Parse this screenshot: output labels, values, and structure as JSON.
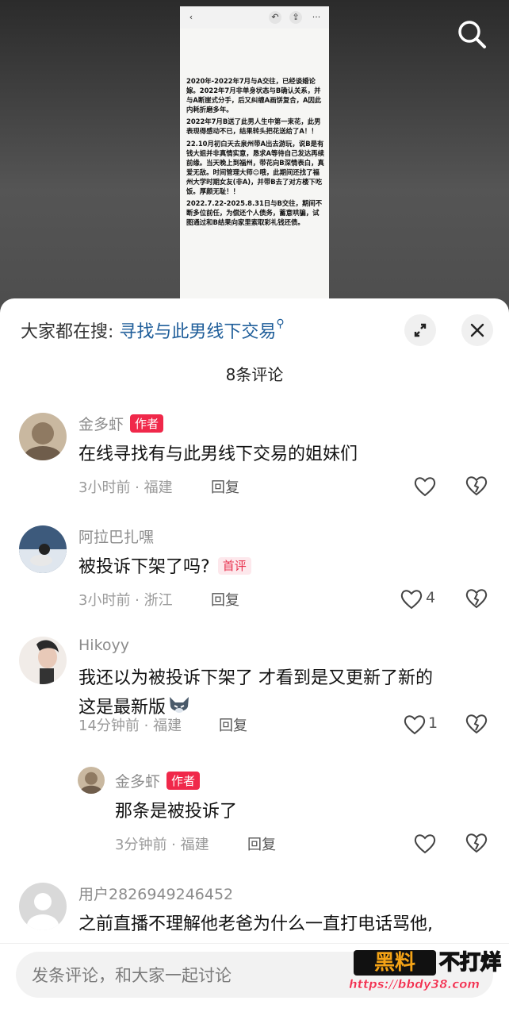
{
  "post_image": {
    "paragraphs": [
      "2020年-2022年7月与A交往，已经谈婚论嫁。2022年7月非单身状态与B确认关系，并与A断崖式分手，后又纠缠A画饼复合，A因此内耗折磨多年。",
      "2022年7月B送了此男人生中第一束花，此男表现得感动不已，结果转头把花送给了A！！",
      "22.10月初白天去泉州带A出去游玩，说B是有钱大姐并非真情实意，恳求A等待自己发达再续前缘。当天晚上到福州，带花向B深情表白，真爱无敌。时间管理大师😊哦，此期间还找了福州大学时期女友(非A)，并带B去了对方楼下吃饭。厚颜无耻！！",
      "2022.7.22-2025.8.31日与B交往，期间不断多位前任，为偿还个人债务，蓄意哄骗，试图通过和B结果向家里索取彩礼钱还债。"
    ]
  },
  "sheet": {
    "suggest_prefix": "大家都在搜: ",
    "suggest_keyword": "寻找与此男线下交易",
    "comment_count_title": "8条评论"
  },
  "comments": [
    {
      "username": "金多虾",
      "author_badge": "作者",
      "text": "在线寻找有与此男线下交易的姐妹们",
      "meta": "3小时前 · 福建",
      "reply": "回复",
      "likes": ""
    },
    {
      "username": "阿拉巴扎嘿",
      "text": "被投诉下架了吗?",
      "first_badge": "首评",
      "meta": "3小时前 · 浙江",
      "reply": "回复",
      "likes": "4"
    },
    {
      "username": "Hikoyy",
      "text_line1": "我还以为被投诉下架了 才看到是又更新了新的",
      "text_line2": "这是最新版",
      "meta": "14分钟前 · 福建",
      "reply": "回复",
      "likes": "1"
    },
    {
      "username": "金多虾",
      "author_badge": "作者",
      "text": "那条是被投诉了",
      "meta": "3分钟前 · 福建",
      "reply": "回复",
      "likes": ""
    },
    {
      "username": "用户2826949246452",
      "text": "之前直播不理解他老爸为什么一直打电话骂他,"
    }
  ],
  "bottom": {
    "input_placeholder": "发条评论，和大家一起讨论",
    "watermark_logo": "黑料",
    "watermark_text": "不打烊",
    "watermark_url": "https://bbdy38.com"
  },
  "colors": {
    "author_badge": "#f0284a",
    "first_badge_text": "#e8334f",
    "suggest_keyword": "#1f5e9a"
  }
}
